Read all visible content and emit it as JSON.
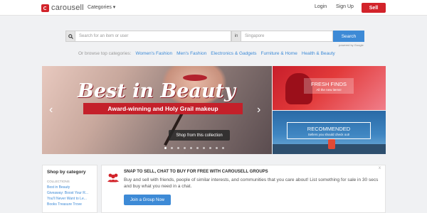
{
  "header": {
    "logo_text": "carousell",
    "categories_label": "Categories ▾",
    "login_label": "Login",
    "signup_label": "Sign Up",
    "sell_label": "Sell"
  },
  "search": {
    "placeholder": "Search for an item or user",
    "in_label": "in",
    "location_placeholder": "Singapore",
    "button_label": "Search",
    "powered_by": "powered by Google"
  },
  "browse": {
    "prefix": "Or browse top categories:",
    "categories": [
      "Women's Fashion",
      "Men's Fashion",
      "Electronics & Gadgets",
      "Furniture & Home",
      "Health & Beauty"
    ]
  },
  "hero": {
    "title": "Best in Beauty",
    "subtitle": "Award-winning and Holy Grail makeup",
    "cta": "Shop from this collection",
    "slide_count": 10,
    "active_slide": 0
  },
  "promos": {
    "fresh": {
      "title": "FRESH FINDS",
      "subtitle": "All the new items!"
    },
    "recommended": {
      "title": "RECOMMENDED",
      "subtitle": "Sellers you should check out!"
    }
  },
  "sidebar": {
    "title": "Shop by category",
    "section": "COLLECTIONS",
    "links": [
      "Best in Beauty",
      "Giveaway: Boost Your R...",
      "You'll Never Want to Le...",
      "Books Treasure Trove"
    ]
  },
  "groups": {
    "title": "SNAP TO SELL, CHAT TO BUY FOR FREE WITH CAROUSELL GROUPS",
    "description": "Buy and sell with friends, people of similar interests, and communities that you care about! List something for sale in 30 secs and buy what you need in a chat.",
    "button_label": "Join a Group Now",
    "close_label": "x"
  },
  "colors": {
    "brand_red": "#d2232a",
    "link_blue": "#3d8ad6",
    "background": "#f0f1f3"
  }
}
